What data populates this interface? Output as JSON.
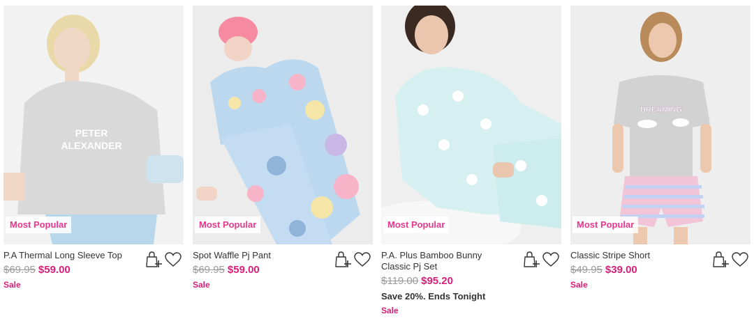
{
  "products": [
    {
      "badge": "Most Popular",
      "title": "P.A Thermal Long Sleeve Top",
      "was_price": "$69.95",
      "now_price": "$59.00",
      "promo": "",
      "sale_label": "Sale",
      "image_text": [
        "PETER",
        "ALEXANDER"
      ]
    },
    {
      "badge": "Most Popular",
      "title": "Spot Waffle Pj Pant",
      "was_price": "$69.95",
      "now_price": "$59.00",
      "promo": "",
      "sale_label": "Sale"
    },
    {
      "badge": "Most Popular",
      "title": "P.A. Plus Bamboo Bunny Classic Pj Set",
      "was_price": "$119.00",
      "now_price": "$95.20",
      "promo": "Save 20%. Ends Tonight",
      "sale_label": "Sale"
    },
    {
      "badge": "Most Popular",
      "title": "Classic Stripe Short",
      "was_price": "$49.95",
      "now_price": "$39.00",
      "promo": "",
      "sale_label": "Sale",
      "image_text": [
        "DREAMING"
      ]
    }
  ],
  "icons": {
    "add_to_bag": "add-to-bag-icon",
    "wishlist": "heart-icon"
  },
  "colors": {
    "accent": "#d81e78",
    "badge_text": "#e8378c",
    "strike": "#9a9a9a"
  }
}
